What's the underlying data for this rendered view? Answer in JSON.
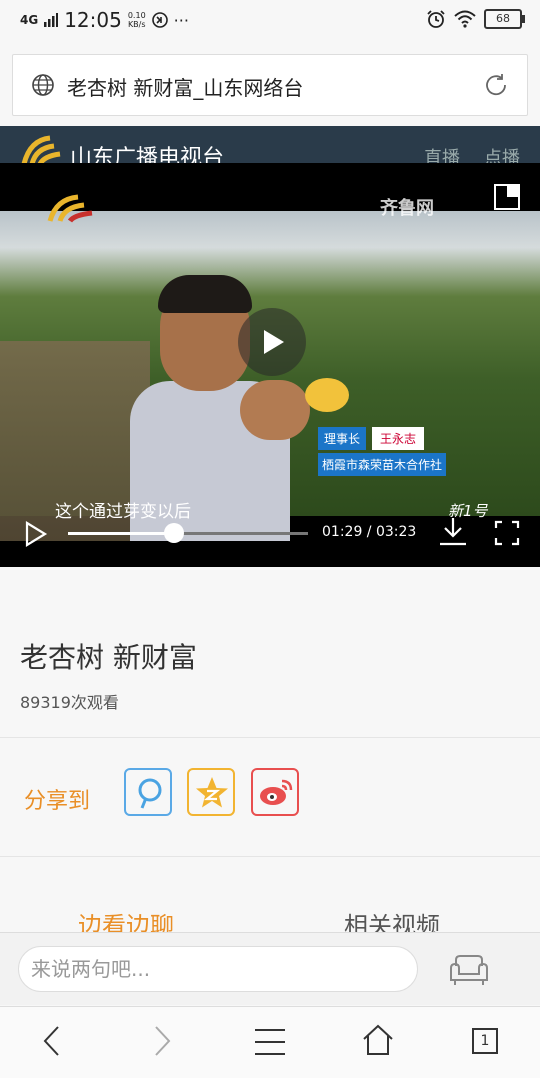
{
  "status_bar": {
    "network": "4G",
    "time": "12:05",
    "speed_value": "0.10",
    "speed_unit": "KB/s",
    "more": "···",
    "battery": "68"
  },
  "address_bar": {
    "url_text": "老杏树 新财富_山东网络台"
  },
  "site_header": {
    "name": "山东广播电视台",
    "nav": [
      "直播",
      "点播"
    ]
  },
  "video": {
    "watermark": "齐鲁网",
    "caption": "这个通过芽变以后",
    "lower_third": {
      "role": "理事长",
      "name": "王永志",
      "org": "栖霞市森荣苗木合作社"
    },
    "channel_bug": "新1号",
    "current_time": "01:29",
    "duration": "03:23",
    "time_display": "01:29 / 03:23",
    "progress_fraction": 0.44
  },
  "content": {
    "title": "老杏树 新财富",
    "views": "89319次观看"
  },
  "share": {
    "label": "分享到",
    "targets": [
      "qq-browser",
      "qzone",
      "weibo"
    ]
  },
  "tabs": [
    "边看边聊",
    "相关视频"
  ],
  "comment": {
    "placeholder": "来说两句吧..."
  },
  "nav": {
    "tab_count": "1"
  }
}
